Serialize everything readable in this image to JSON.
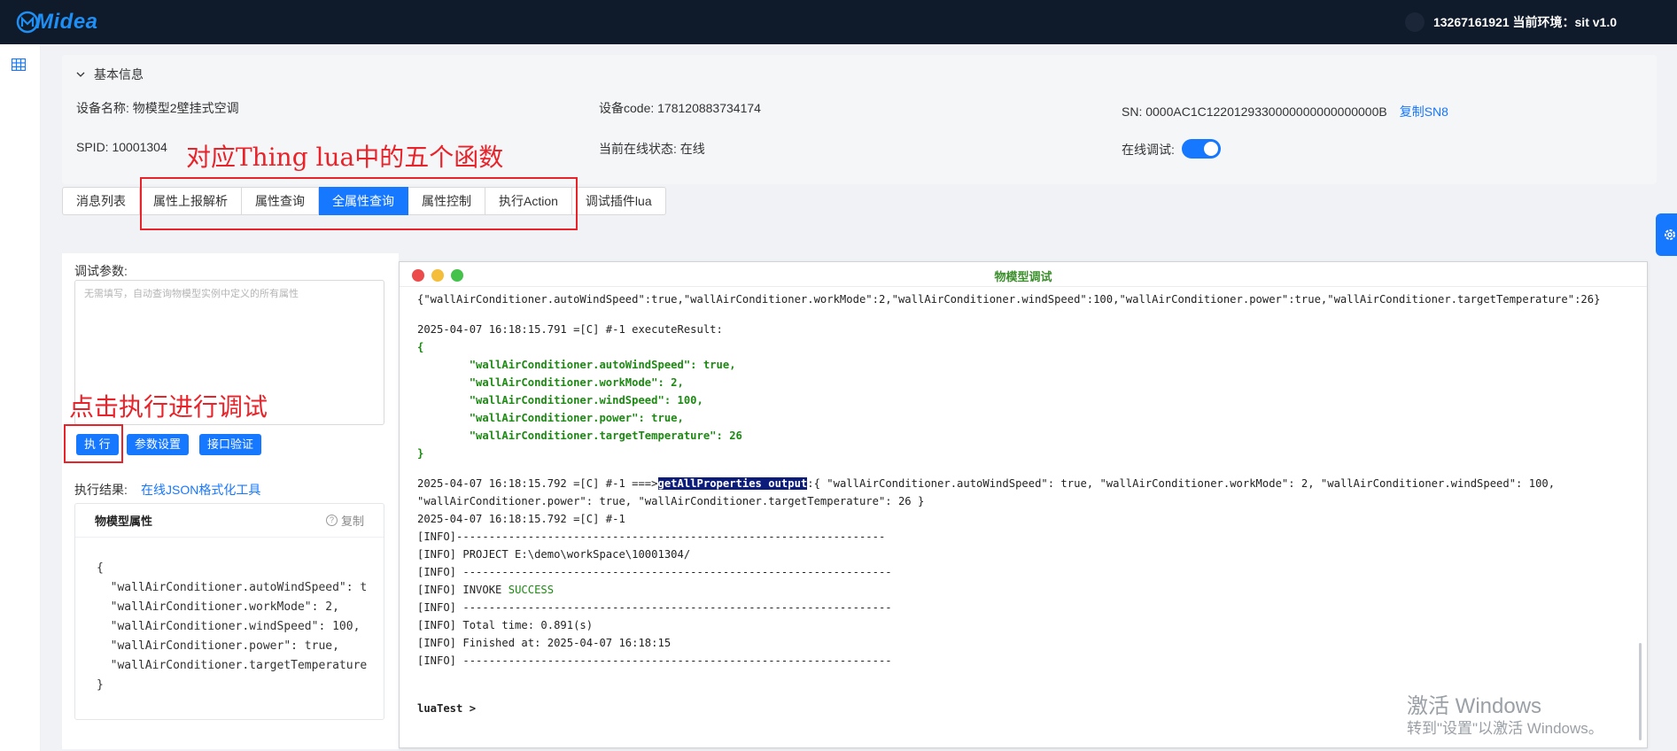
{
  "header": {
    "logo_text": "Midea",
    "user_info": "13267161921 当前环境：sit v1.0"
  },
  "info": {
    "section_title": "基本信息",
    "device_name": "设备名称: 物模型2壁挂式空调",
    "device_code": "设备code: 178120883734174",
    "sn": "SN: 0000AC1C1220129330000000000000000B",
    "copy_sn": "复制SN8",
    "spid": "SPID: 10001304",
    "online_status": "当前在线状态: 在线",
    "online_debug_label": "在线调试:"
  },
  "tabs": [
    {
      "label": "消息列表",
      "active": false
    },
    {
      "label": "属性上报解析",
      "active": false
    },
    {
      "label": "属性查询",
      "active": false
    },
    {
      "label": "全属性查询",
      "active": true
    },
    {
      "label": "属性控制",
      "active": false
    },
    {
      "label": "执行Action",
      "active": false
    },
    {
      "label": "调试插件lua",
      "active": false
    }
  ],
  "annotations": {
    "tabs_note": "对应Thing lua中的五个函数",
    "exec_note": "点击执行进行调试"
  },
  "debug": {
    "params_label": "调试参数:",
    "params_placeholder": "无需填写，自动查询物模型实例中定义的所有属性",
    "execute": "执 行",
    "param_settings": "参数设置",
    "interface_verify": "接口验证",
    "result_label": "执行结果:",
    "json_tool": "在线JSON格式化工具",
    "result_title": "物模型属性",
    "copy": "复制",
    "result_lines": [
      "{",
      "  \"wallAirConditioner.autoWindSpeed\": t",
      "  \"wallAirConditioner.workMode\": 2,",
      "  \"wallAirConditioner.windSpeed\": 100,",
      "  \"wallAirConditioner.power\": true,",
      "  \"wallAirConditioner.targetTemperature",
      "}"
    ]
  },
  "terminal": {
    "title": "物模型调试",
    "line_01": "{\"wallAirConditioner.autoWindSpeed\":true,\"wallAirConditioner.workMode\":2,\"wallAirConditioner.windSpeed\":100,\"wallAirConditioner.power\":true,\"wallAirConditioner.targetTemperature\":26}",
    "line_03": "2025-04-07 16:18:15.791 =[C] #-1 executeResult:",
    "line_04": "{",
    "line_05": "        \"wallAirConditioner.autoWindSpeed\": true,",
    "line_06": "        \"wallAirConditioner.workMode\": 2,",
    "line_07": "        \"wallAirConditioner.windSpeed\": 100,",
    "line_08": "        \"wallAirConditioner.power\": true,",
    "line_09": "        \"wallAirConditioner.targetTemperature\": 26",
    "line_10": "}",
    "line_12_prefix": "2025-04-07 16:18:15.792 =[C] #-1 ===>",
    "line_12_highlight": "getAllProperties output",
    "line_12_suffix": ":{ \"wallAirConditioner.autoWindSpeed\": true, \"wallAirConditioner.workMode\": 2, \"wallAirConditioner.windSpeed\": 100,",
    "line_13": "\"wallAirConditioner.power\": true, \"wallAirConditioner.targetTemperature\": 26 }",
    "line_14": "2025-04-07 16:18:15.792 =[C] #-1",
    "line_15": "[INFO]------------------------------------------------------------------",
    "line_16": "[INFO] PROJECT E:\\demo\\workSpace\\10001304/",
    "line_17": "[INFO] ------------------------------------------------------------------",
    "line_18_prefix": "[INFO] INVOKE ",
    "line_18_success": "SUCCESS",
    "line_19": "[INFO] ------------------------------------------------------------------",
    "line_20": "[INFO] Total time: 0.891(s)",
    "line_21": "[INFO] Finished at: 2025-04-07 16:18:15",
    "line_22": "[INFO] ------------------------------------------------------------------",
    "prompt": "luaTest >"
  },
  "watermark": {
    "line1": "激活 Windows",
    "line2": "转到\"设置\"以激活 Windows。"
  }
}
